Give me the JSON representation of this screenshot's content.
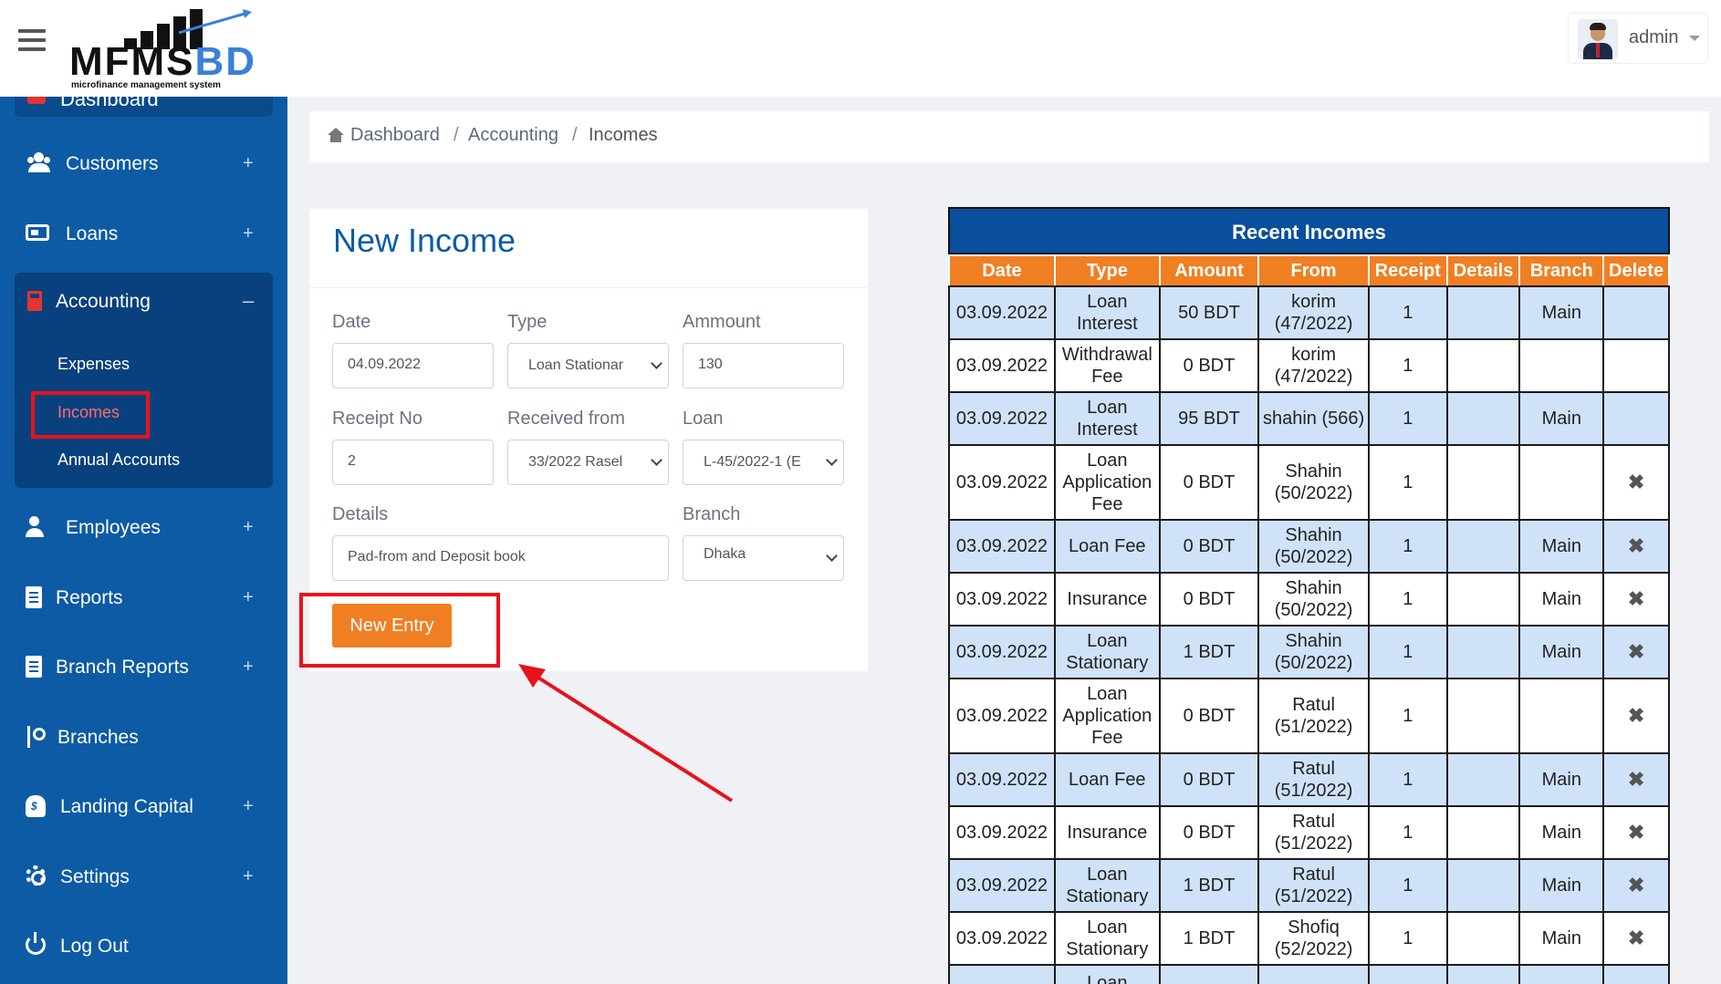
{
  "logo": {
    "main": "MFMS",
    "accent": "BD",
    "tagline": "microfinance management system"
  },
  "user": {
    "name": "admin"
  },
  "sidebar": {
    "top_partial": "Dashboard",
    "items": [
      {
        "label": "Customers",
        "toggle": "+"
      },
      {
        "label": "Loans",
        "toggle": "+"
      },
      {
        "label": "Accounting",
        "toggle": "–"
      },
      {
        "label": "Employees",
        "toggle": "+"
      },
      {
        "label": "Reports",
        "toggle": "+"
      },
      {
        "label": "Branch Reports",
        "toggle": "+"
      },
      {
        "label": "Branches"
      },
      {
        "label": "Landing Capital",
        "toggle": "+"
      },
      {
        "label": "Settings",
        "toggle": "+"
      },
      {
        "label": "Log Out"
      }
    ],
    "accounting_sub": [
      "Expenses",
      "Incomes",
      "Annual Accounts"
    ]
  },
  "breadcrumb": [
    "Dashboard",
    "/",
    "Accounting",
    "/",
    "Incomes"
  ],
  "form": {
    "title": "New Income",
    "date_label": "Date",
    "date_value": "04.09.2022",
    "type_label": "Type",
    "type_value": "Loan Stationar",
    "amount_label": "Ammount",
    "amount_value": "130",
    "receipt_label": "Receipt No",
    "receipt_value": "2",
    "received_label": "Received from",
    "received_value": "33/2022 Rasel",
    "loan_label": "Loan",
    "loan_value": "L-45/2022-1 (E",
    "details_label": "Details",
    "details_value": "Pad-from and Deposit book",
    "branch_label": "Branch",
    "branch_value": "Dhaka",
    "submit": "New Entry"
  },
  "table": {
    "title": "Recent Incomes",
    "columns": [
      "Date",
      "Type",
      "Amount",
      "From",
      "Receipt",
      "Details",
      "Branch",
      "Delete"
    ],
    "delete_icon": "✖",
    "rows": [
      [
        "03.09.2022",
        "Loan Interest",
        "50 BDT",
        "korim (47/2022)",
        "1",
        "",
        "Main",
        ""
      ],
      [
        "03.09.2022",
        "Withdrawal Fee",
        "0 BDT",
        "korim (47/2022)",
        "1",
        "",
        "",
        ""
      ],
      [
        "03.09.2022",
        "Loan Interest",
        "95 BDT",
        "shahin (566)",
        "1",
        "",
        "Main",
        ""
      ],
      [
        "03.09.2022",
        "Loan Application Fee",
        "0 BDT",
        "Shahin (50/2022)",
        "1",
        "",
        "",
        "x"
      ],
      [
        "03.09.2022",
        "Loan Fee",
        "0 BDT",
        "Shahin (50/2022)",
        "1",
        "",
        "Main",
        "x"
      ],
      [
        "03.09.2022",
        "Insurance",
        "0 BDT",
        "Shahin (50/2022)",
        "1",
        "",
        "Main",
        "x"
      ],
      [
        "03.09.2022",
        "Loan Stationary",
        "1 BDT",
        "Shahin (50/2022)",
        "1",
        "",
        "Main",
        "x"
      ],
      [
        "03.09.2022",
        "Loan Application Fee",
        "0 BDT",
        "Ratul (51/2022)",
        "1",
        "",
        "",
        "x"
      ],
      [
        "03.09.2022",
        "Loan Fee",
        "0 BDT",
        "Ratul (51/2022)",
        "1",
        "",
        "Main",
        "x"
      ],
      [
        "03.09.2022",
        "Insurance",
        "0 BDT",
        "Ratul (51/2022)",
        "1",
        "",
        "Main",
        "x"
      ],
      [
        "03.09.2022",
        "Loan Stationary",
        "1 BDT",
        "Ratul (51/2022)",
        "1",
        "",
        "Main",
        "x"
      ],
      [
        "03.09.2022",
        "Loan Stationary",
        "1 BDT",
        "Shofiq (52/2022)",
        "1",
        "",
        "Main",
        "x"
      ],
      [
        "",
        "Loan",
        "",
        "",
        "",
        "",
        "",
        ""
      ]
    ]
  },
  "colors": {
    "sidebar": "#0d5ba5",
    "accent": "#f07f23",
    "highlight": "#e8121b",
    "row_alt": "#cfe2f8"
  }
}
